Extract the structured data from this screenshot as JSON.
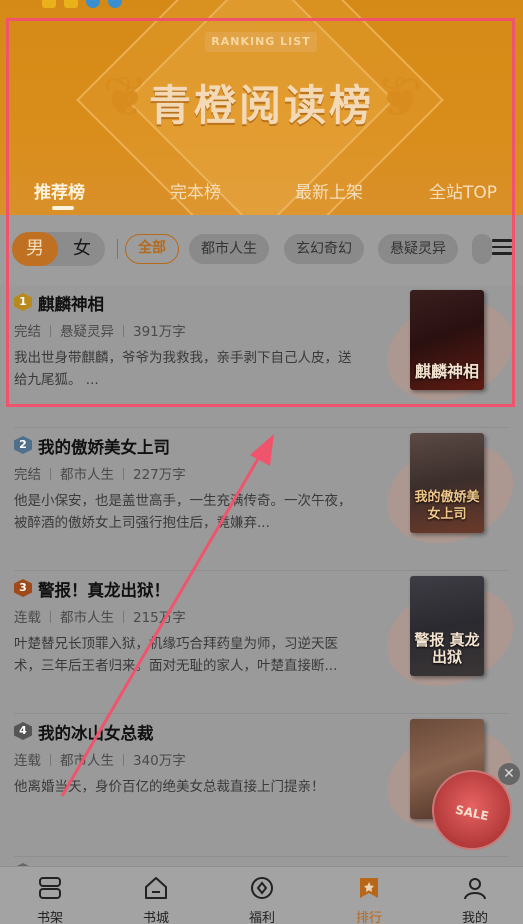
{
  "header": {
    "ribbon": "RANKING LIST",
    "title": "青橙阅读榜",
    "tabs": [
      {
        "label": "推荐榜",
        "active": true
      },
      {
        "label": "完本榜",
        "active": false
      },
      {
        "label": "最新上架",
        "active": false
      },
      {
        "label": "全站TOP",
        "active": false
      }
    ]
  },
  "filters": {
    "gender": [
      "男",
      "女"
    ],
    "selected_gender": "男",
    "categories": [
      "全部",
      "都市人生",
      "玄幻奇幻",
      "悬疑灵异"
    ],
    "selected_category": "全部",
    "menu_icon": "menu-icon"
  },
  "books": [
    {
      "rank": "1",
      "title": "麒麟神相",
      "status": "完结",
      "genre": "悬疑灵异",
      "words": "391万字",
      "desc": "我出世身带麒麟，爷爷为我救我，亲手剥下自己人皮，送给九尾狐。 ...",
      "cover_text": "麒麟神相",
      "rank_color": "#b88a1e"
    },
    {
      "rank": "2",
      "title": "我的傲娇美女上司",
      "status": "完结",
      "genre": "都市人生",
      "words": "227万字",
      "desc": "他是小保安，也是盖世高手，一生充满传奇。一次午夜，被醉酒的傲娇女上司强行抱住后，竟嫌弃...",
      "cover_text": "我的傲娇美女上司",
      "rank_color": "#4f6f8a"
    },
    {
      "rank": "3",
      "title": "警报！真龙出狱！",
      "status": "连载",
      "genre": "都市人生",
      "words": "215万字",
      "desc": "叶楚替兄长顶罪入狱，机缘巧合拜药皇为师，习逆天医术，三年后王者归来。面对无耻的家人，叶楚直接断...",
      "cover_text": "警报 真龙出狱",
      "rank_color": "#a04a1c"
    },
    {
      "rank": "4",
      "title": "我的冰山女总裁",
      "status": "连载",
      "genre": "都市人生",
      "words": "340万字",
      "desc": "他离婚当天，身价百亿的绝美女总裁直接上门提亲！",
      "cover_text": "",
      "rank_color": "#555555"
    }
  ],
  "promo": {
    "label": "SALE",
    "close": "✕"
  },
  "bottom_nav": [
    {
      "label": "书架",
      "icon": "bookshelf-icon"
    },
    {
      "label": "书城",
      "icon": "home-icon"
    },
    {
      "label": "福利",
      "icon": "coin-icon"
    },
    {
      "label": "排行",
      "icon": "ranking-icon",
      "active": true
    },
    {
      "label": "我的",
      "icon": "profile-icon"
    }
  ]
}
